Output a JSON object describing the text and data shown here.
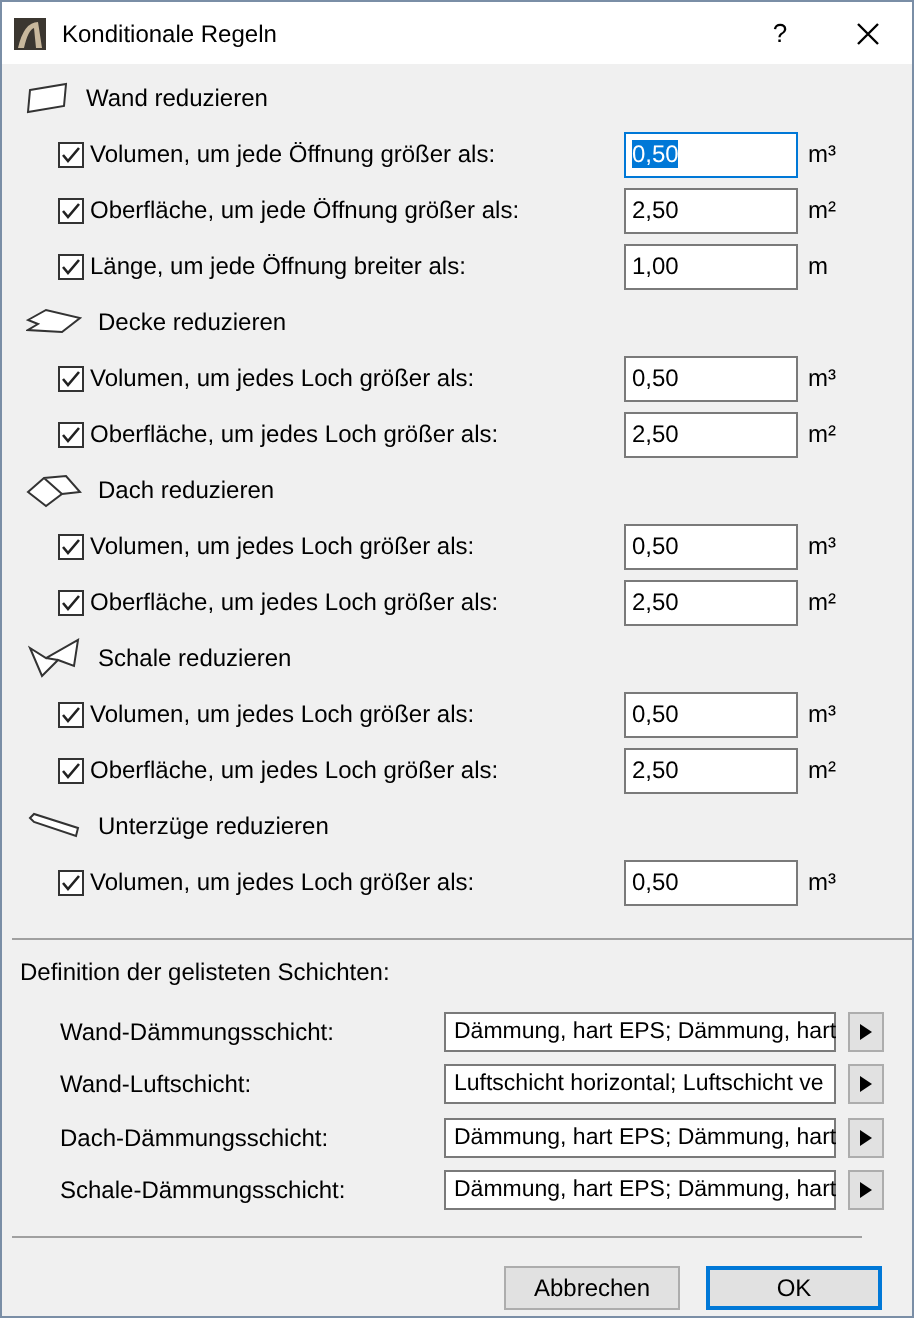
{
  "window": {
    "title": "Konditionale Regeln",
    "help": "?"
  },
  "sections": [
    {
      "kind": "wall",
      "title": "Wand reduzieren",
      "rules": [
        {
          "label": "Volumen, um jede Öffnung größer als:",
          "checked": true,
          "value": "0,50",
          "unit": "m³",
          "focused": true
        },
        {
          "label": "Oberfläche, um jede Öffnung größer als:",
          "checked": true,
          "value": "2,50",
          "unit": "m²",
          "focused": false
        },
        {
          "label": "Länge, um jede Öffnung breiter als:",
          "checked": true,
          "value": "1,00",
          "unit": "m",
          "focused": false
        }
      ]
    },
    {
      "kind": "slab",
      "title": "Decke reduzieren",
      "rules": [
        {
          "label": "Volumen, um jedes Loch größer als:",
          "checked": true,
          "value": "0,50",
          "unit": "m³",
          "focused": false
        },
        {
          "label": "Oberfläche, um jedes Loch größer als:",
          "checked": true,
          "value": "2,50",
          "unit": "m²",
          "focused": false
        }
      ]
    },
    {
      "kind": "roof",
      "title": "Dach reduzieren",
      "rules": [
        {
          "label": "Volumen, um jedes Loch größer als:",
          "checked": true,
          "value": "0,50",
          "unit": "m³",
          "focused": false
        },
        {
          "label": "Oberfläche, um jedes Loch größer als:",
          "checked": true,
          "value": "2,50",
          "unit": "m²",
          "focused": false
        }
      ]
    },
    {
      "kind": "shell",
      "title": "Schale reduzieren",
      "rules": [
        {
          "label": "Volumen, um jedes Loch größer als:",
          "checked": true,
          "value": "0,50",
          "unit": "m³",
          "focused": false
        },
        {
          "label": "Oberfläche, um jedes Loch größer als:",
          "checked": true,
          "value": "2,50",
          "unit": "m²",
          "focused": false
        }
      ]
    },
    {
      "kind": "beam",
      "title": "Unterzüge reduzieren",
      "rules": [
        {
          "label": "Volumen, um jedes Loch größer als:",
          "checked": true,
          "value": "0,50",
          "unit": "m³",
          "focused": false
        }
      ]
    }
  ],
  "layers": {
    "title": "Definition der gelisteten Schichten:",
    "rows": [
      {
        "label": "Wand-Dämmungsschicht:",
        "value": "Dämmung, hart EPS; Dämmung, hart"
      },
      {
        "label": "Wand-Luftschicht:",
        "value": "Luftschicht horizontal; Luftschicht ve"
      },
      {
        "label": "Dach-Dämmungsschicht:",
        "value": "Dämmung, hart EPS; Dämmung, hart"
      },
      {
        "label": "Schale-Dämmungsschicht:",
        "value": "Dämmung, hart EPS; Dämmung, hart"
      }
    ]
  },
  "buttons": [
    {
      "label": "Abbrechen",
      "default": false
    },
    {
      "label": "OK",
      "default": true
    }
  ]
}
